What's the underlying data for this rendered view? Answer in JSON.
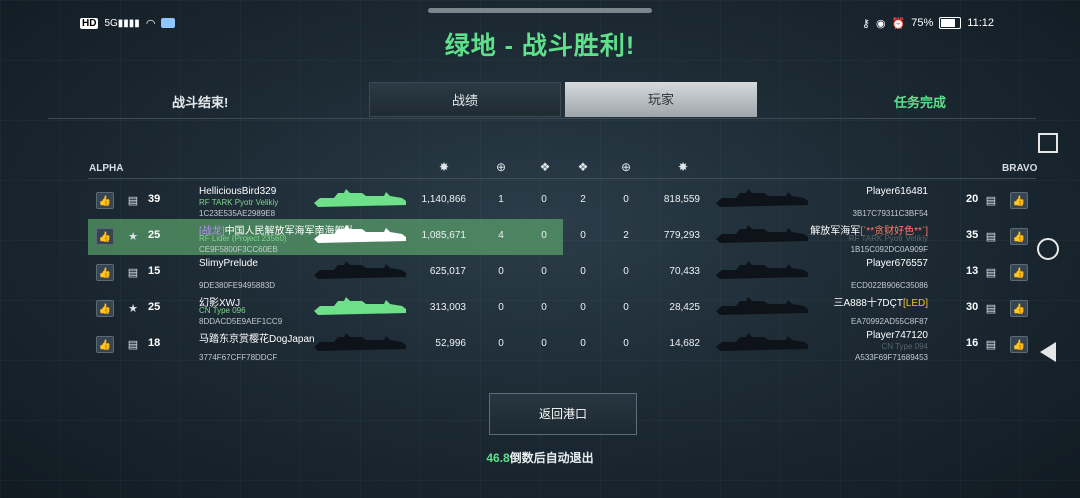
{
  "status_bar": {
    "left_text": "HD 5G",
    "battery": "75%",
    "time": "11:12"
  },
  "title": "绿地 - 战斗胜利!",
  "tabs": {
    "left": "战斗结束!",
    "tab1": "战绩",
    "tab2": "玩家",
    "right": "任务完成"
  },
  "teams": {
    "left": "ALPHA",
    "right": "BRAVO"
  },
  "columns": [
    "damage-icon",
    "target-icon",
    "shield-icon",
    "shield-icon",
    "target-icon",
    "damage-icon"
  ],
  "alpha": [
    {
      "level": "39",
      "name": "HelliciousBird329",
      "ship": "RF TARK Pyotr Velikiy",
      "id": "1C23E535AE2989E8",
      "damage": "1,140,866",
      "kills": "1",
      "s1": "0",
      "rank_icon": "medal-icon",
      "ship_color": "#6fe08a"
    },
    {
      "level": "25",
      "clan": "[战龙]",
      "name": "中国人民解放军海军南海舰队",
      "ship": "RF Lider (Project 23560)",
      "id": "CE9F5800F3CC60EB",
      "damage": "1,085,671",
      "kills": "4",
      "s1": "0",
      "rank_icon": "stars-icon",
      "ship_color": "#ffffff",
      "highlight": true
    },
    {
      "level": "15",
      "name": "SlimyPrelude",
      "ship": "",
      "id": "9DE380FE9495883D",
      "damage": "625,017",
      "kills": "0",
      "s1": "0",
      "rank_icon": "chevron-icon",
      "ship_color": "#0d1318"
    },
    {
      "level": "25",
      "name": "幻影XWJ",
      "ship": "CN Type 096",
      "id": "8DDACD5E9AEF1CC9",
      "damage": "313,003",
      "kills": "0",
      "s1": "0",
      "rank_icon": "stars-icon",
      "ship_color": "#6fe08a"
    },
    {
      "level": "18",
      "name": "马踏东京赏樱花DogJapan",
      "ship": "",
      "id": "3774F67CFF78DDCF",
      "damage": "52,996",
      "kills": "0",
      "s1": "0",
      "rank_icon": "bars-icon",
      "ship_color": "#0d1318"
    }
  ],
  "bravo": [
    {
      "level": "20",
      "name": "Player616481",
      "ship": "",
      "id": "3B17C79311C3BF54",
      "damage": "818,559",
      "kills": "0",
      "s1": "2"
    },
    {
      "level": "35",
      "name": "解放军海军",
      "tag": "[`**贪财好色**`]",
      "ship": "RF TARK Pyotr Velikiy",
      "id": "1B15C092DC0A909F",
      "damage": "779,293",
      "kills": "2",
      "s1": "0"
    },
    {
      "level": "13",
      "name": "Player676557",
      "ship": "",
      "id": "ECD022B906C35086",
      "damage": "70,433",
      "kills": "0",
      "s1": "0"
    },
    {
      "level": "30",
      "name": "三A888十7DÇT",
      "tag": "[LED]",
      "ship": "",
      "id": "EA70992AD55C8F87",
      "damage": "28,425",
      "kills": "0",
      "s1": "0"
    },
    {
      "level": "16",
      "name": "Player747120",
      "ship": "CN Type 094",
      "id": "A533F69F71689453",
      "damage": "14,682",
      "kills": "0",
      "s1": "0"
    }
  ],
  "buttons": {
    "return_port": "返回港口"
  },
  "countdown": {
    "value": "46.8",
    "text": "倒数后自动退出"
  }
}
